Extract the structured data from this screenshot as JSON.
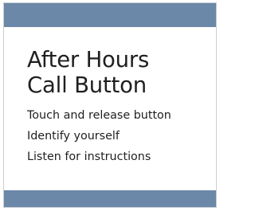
{
  "sign": {
    "title_lines": [
      "After Hours",
      "Call Button"
    ],
    "instructions": [
      "Touch and release button",
      "Identify yourself",
      "Listen for instructions"
    ]
  },
  "colors": {
    "band": "#6b88a8",
    "text": "#1f1f1f",
    "background": "#ffffff"
  }
}
